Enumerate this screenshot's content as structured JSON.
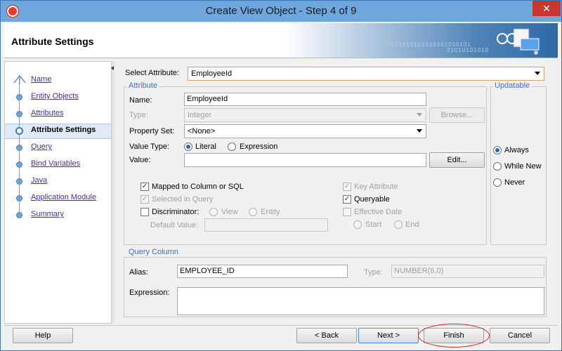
{
  "window": {
    "title": "Create View Object - Step 4 of 9",
    "close_glyph": "✕"
  },
  "header": {
    "title": "Attribute Settings",
    "binary_line1": "0101010101010101010101",
    "binary_line2": "01010101010"
  },
  "nav": {
    "items": [
      {
        "label": "Name"
      },
      {
        "label": "Entity Objects"
      },
      {
        "label": "Attributes"
      },
      {
        "label": "Attribute Settings",
        "active": true
      },
      {
        "label": "Query"
      },
      {
        "label": "Bind Variables"
      },
      {
        "label": "Java"
      },
      {
        "label": "Application Module"
      },
      {
        "label": "Summary"
      }
    ]
  },
  "form": {
    "select_attribute_label": "Select Attribute:",
    "select_attribute_value": "EmployeeId",
    "attribute_group_label": "Attribute",
    "name_label": "Name:",
    "name_value": "EmployeeId",
    "type_label": "Type:",
    "type_value": "Integer",
    "browse_label": "Browse...",
    "property_set_label": "Property Set:",
    "property_set_value": "<None>",
    "value_type_label": "Value Type:",
    "value_type_options": {
      "literal": "Literal",
      "expression": "Expression"
    },
    "value_type_selected": "Literal",
    "value_label": "Value:",
    "value_value": "",
    "edit_label": "Edit...",
    "checkboxes": {
      "mapped": {
        "label": "Mapped to Column or SQL",
        "checked": true,
        "enabled": true
      },
      "selected_in_query": {
        "label": "Selected in Query",
        "checked": true,
        "enabled": false
      },
      "discriminator": {
        "label": "Discriminator:",
        "checked": false,
        "enabled": true
      },
      "key_attribute": {
        "label": "Key Attribute",
        "checked": true,
        "enabled": false
      },
      "queryable": {
        "label": "Queryable",
        "checked": true,
        "enabled": true
      },
      "effective_date": {
        "label": "Effective Date",
        "checked": false,
        "enabled": false
      }
    },
    "discriminator_options": {
      "view": "View",
      "entity": "Entity"
    },
    "default_value_label": "Default Value:",
    "effective_date_options": {
      "start": "Start",
      "end": "End"
    },
    "updatable": {
      "label": "Updatable",
      "options": [
        "Always",
        "While New",
        "Never"
      ],
      "selected": "Always"
    },
    "query_column": {
      "label": "Query Column",
      "alias_label": "Alias:",
      "alias_value": "EMPLOYEE_ID",
      "type_label": "Type:",
      "type_value": "NUMBER(6,0)",
      "expression_label": "Expression:",
      "expression_value": ""
    }
  },
  "footer": {
    "help": "Help",
    "back": "< Back",
    "next": "Next >",
    "finish": "Finish",
    "cancel": "Cancel"
  },
  "check_glyph": "✓"
}
